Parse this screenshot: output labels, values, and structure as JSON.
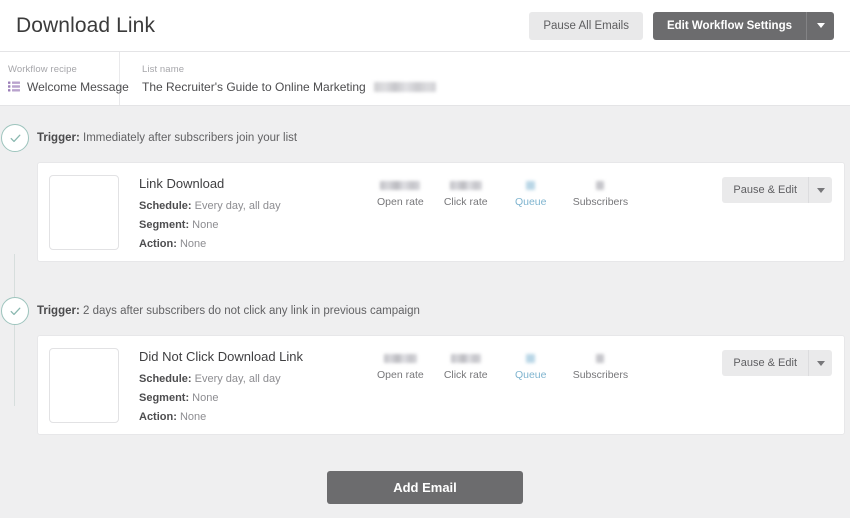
{
  "header": {
    "title": "Download Link",
    "pause_all_label": "Pause All Emails",
    "edit_settings_label": "Edit Workflow Settings",
    "dropdown_icon": "chevron-down-icon"
  },
  "meta": {
    "recipe_label": "Workflow recipe",
    "recipe_value": "Welcome Message",
    "recipe_icon": "list-icon",
    "list_label": "List name",
    "list_value": "The Recruiter's Guide to Online Marketing",
    "list_value_redacted": true
  },
  "colors": {
    "accent_link": "#7fb4cf",
    "node_ring": "#9dc4bd",
    "primary_button": "#6c6c6e",
    "secondary_button": "#e9e9ea",
    "page_background": "#efeff0",
    "card_background": "#ffffff",
    "recipe_icon": "#9b7fb8"
  },
  "steps": [
    {
      "trigger_prefix": "Trigger:",
      "trigger_text": " Immediately after subscribers join your list",
      "node_icon": "check-circle-icon",
      "email": {
        "name": "Link Download",
        "thumbnail": "email-thumbnail",
        "details": [
          {
            "label": "Schedule:",
            "value": " Every day, all day"
          },
          {
            "label": "Segment:",
            "value": " None"
          },
          {
            "label": "Action:",
            "value": " None"
          }
        ],
        "stats": [
          {
            "label": "Open rate",
            "value_redacted": true,
            "style": "wide",
            "is_link": false
          },
          {
            "label": "Click rate",
            "value_redacted": true,
            "style": "wide",
            "is_link": false
          },
          {
            "label": "Queue",
            "value_redacted": true,
            "style": "narrow",
            "is_link": true
          },
          {
            "label": "Subscribers",
            "value_redacted": true,
            "style": "gray",
            "is_link": false
          }
        ],
        "action_label": "Pause & Edit",
        "action_dropdown_icon": "chevron-down-icon"
      }
    },
    {
      "trigger_prefix": "Trigger:",
      "trigger_text": " 2 days after subscribers do not click any link in previous campaign",
      "node_icon": "check-circle-icon",
      "email": {
        "name": "Did Not Click Download Link",
        "thumbnail": "email-thumbnail",
        "details": [
          {
            "label": "Schedule:",
            "value": " Every day, all day"
          },
          {
            "label": "Segment:",
            "value": " None"
          },
          {
            "label": "Action:",
            "value": " None"
          }
        ],
        "stats": [
          {
            "label": "Open rate",
            "value_redacted": true,
            "style": "wide",
            "is_link": false
          },
          {
            "label": "Click rate",
            "value_redacted": true,
            "style": "wide",
            "is_link": false
          },
          {
            "label": "Queue",
            "value_redacted": true,
            "style": "narrow",
            "is_link": true
          },
          {
            "label": "Subscribers",
            "value_redacted": true,
            "style": "gray",
            "is_link": false
          }
        ],
        "action_label": "Pause & Edit",
        "action_dropdown_icon": "chevron-down-icon"
      }
    }
  ],
  "footer": {
    "add_email_label": "Add Email"
  }
}
